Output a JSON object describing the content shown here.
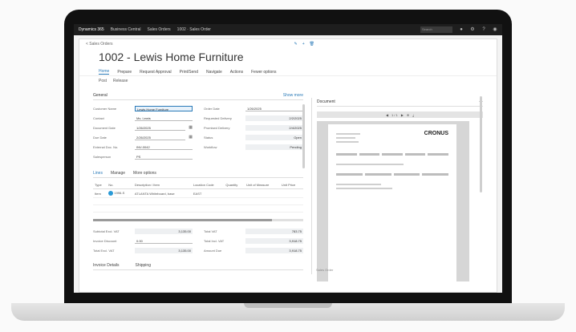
{
  "topbar": {
    "product": "Dynamics 365",
    "app": "Business Central",
    "context": "Sales Orders",
    "path": "1002 · Sales Order",
    "search_placeholder": "Search"
  },
  "window": {
    "breadcrumb": "< Sales Orders",
    "title": "1002 - Lewis Home Furniture",
    "menu": [
      "Home",
      "Prepare",
      "Request Approval",
      "Print/Send",
      "Navigate",
      "Actions",
      "Fewer options"
    ],
    "subactions": [
      "Post",
      "Release"
    ]
  },
  "general": {
    "heading": "General",
    "show_more": "Show more",
    "fields_left": [
      {
        "label": "Customer Name",
        "value": "Lewis Home Furniture"
      },
      {
        "label": "Contact",
        "value": "Ms. Lewis"
      },
      {
        "label": "Document Date",
        "value": "1/26/2025"
      },
      {
        "label": "Due Date",
        "value": "2/26/2025"
      },
      {
        "label": "External Doc. No.",
        "value": "INV-0042"
      },
      {
        "label": "Salesperson",
        "value": "PS"
      }
    ],
    "fields_right": [
      {
        "label": "Order Date",
        "value": "1/26/2025"
      },
      {
        "label": "Requested Delivery",
        "value": "2/2/2025"
      },
      {
        "label": "Promised Delivery",
        "value": "2/4/2025"
      },
      {
        "label": "Status",
        "value": "Open"
      },
      {
        "label": "Workflow",
        "value": "Pending"
      }
    ]
  },
  "lines": {
    "tabs": [
      "Lines",
      "Manage",
      "More options"
    ],
    "headers": [
      "Type",
      "No.",
      "Description / Item",
      "Location Code",
      "Quantity",
      "Unit of Measure",
      "Unit Price"
    ],
    "rows": [
      {
        "type": "Item",
        "no": "1996-S",
        "desc": "ATLANTA Whiteboard, base",
        "loc": "EAST",
        "qty": "",
        "uom": "",
        "price": ""
      },
      {
        "type": "",
        "no": "",
        "desc": "",
        "loc": "",
        "qty": "",
        "uom": "",
        "price": ""
      },
      {
        "type": "",
        "no": "",
        "desc": "",
        "loc": "",
        "qty": "",
        "uom": "",
        "price": ""
      }
    ],
    "progress": 0.85
  },
  "totals": {
    "left": [
      {
        "label": "Subtotal Excl. VAT",
        "value": "3,135.00"
      },
      {
        "label": "Invoice Discount",
        "value": "0.00"
      },
      {
        "label": "Total Excl. VAT",
        "value": "3,135.00"
      }
    ],
    "right": [
      {
        "label": "Total VAT",
        "value": "783.75"
      },
      {
        "label": "Total Incl. VAT",
        "value": "3,918.75"
      },
      {
        "label": "Amount Due",
        "value": "3,918.75"
      }
    ]
  },
  "bottom_tabs": [
    "Invoice Details",
    "Shipping"
  ],
  "preview": {
    "heading": "Document",
    "toolbar": "1 / 1",
    "company": "CRONUS",
    "caption": "Sales Order"
  },
  "colors": {
    "accent": "#2a7ab8",
    "topbar": "#1e1e1e"
  }
}
